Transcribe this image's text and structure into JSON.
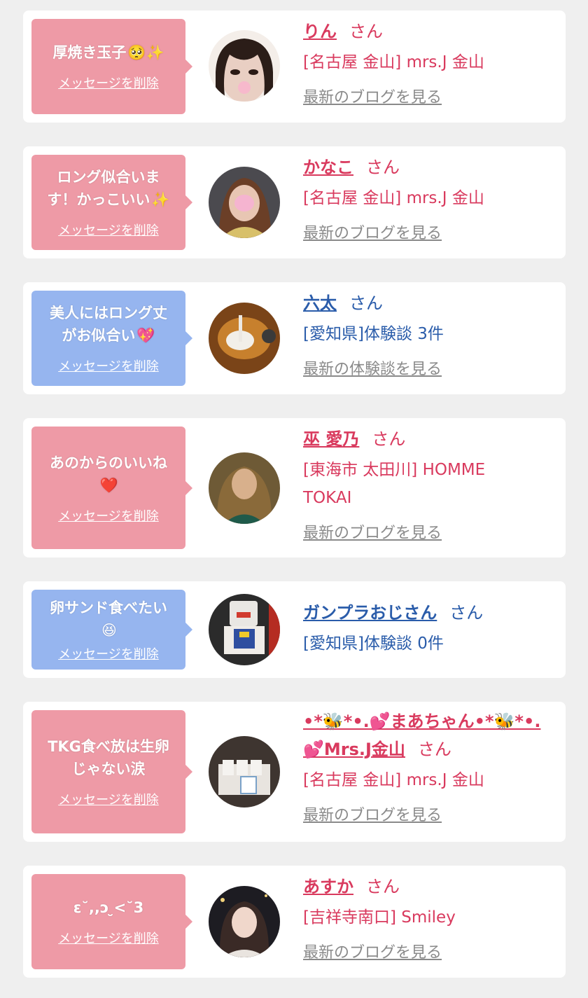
{
  "colors": {
    "pink": "#d93a5e",
    "blue": "#2a5caa",
    "bubble_pink": "#ee9aa6",
    "bubble_blue": "#96b5ef",
    "link_gray": "#8a8a8a"
  },
  "delete_label": "メッセージを削除",
  "san": "さん",
  "items": [
    {
      "message": "厚焼き玉子",
      "emoji": "🥺✨",
      "name": "りん",
      "shop": "[名古屋 金山] mrs.J 金山",
      "latest": "最新のブログを見る"
    },
    {
      "message": "ロング似合いま\nす！かっこいい",
      "emoji": "✨",
      "name": "かなこ",
      "shop": "[名古屋 金山] mrs.J 金山",
      "latest": "最新のブログを見る"
    },
    {
      "message": "美人にはロング丈\nがお似合い",
      "emoji": "💖",
      "name": "六太",
      "shop": "[愛知県]体験談 3件",
      "latest": "最新の体験談を見る"
    },
    {
      "message": "あのからのいいね",
      "emoji": "❤️",
      "name": "巫 愛乃",
      "shop": "[東海市 太田川] HOMME\nTOKAI",
      "latest": "最新のブログを見る"
    },
    {
      "message": "卵サンド食べたい",
      "emoji": "😆",
      "name": "ガンプラおじさん",
      "shop": "[愛知県]体験談 0件",
      "latest": ""
    },
    {
      "message": "TKG食べ放は生卵\nじゃない涙",
      "emoji": "",
      "name": "•*🐝*•.💕まあちゃん•*🐝*•.\n💕Mrs.J金山",
      "shop": "[名古屋 金山] mrs.J 金山",
      "latest": "最新のブログを見る"
    },
    {
      "message": "ε˘,,ↄ ̮<˘3",
      "emoji": "",
      "name": "あすか",
      "shop": "[吉祥寺南口] Smiley",
      "latest": "最新のブログを見る"
    }
  ]
}
